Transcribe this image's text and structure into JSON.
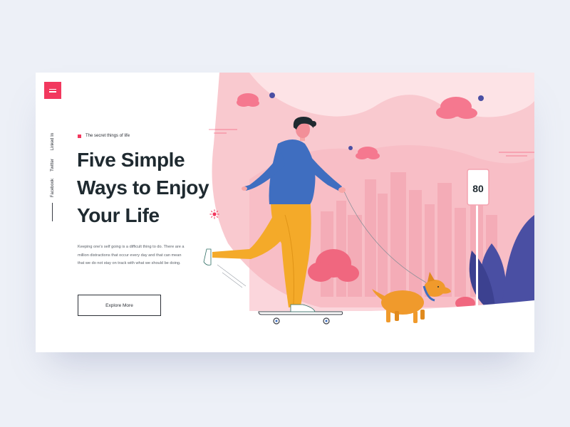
{
  "hero": {
    "eyebrow": "The secret things of life",
    "headline_line1": "Five Simple",
    "headline_line2": "Ways to Enjoy",
    "headline_line3": "Your Life",
    "description": "Keeping one's self going is a difficult thing to do. There are a million distractions that occur every day and that can mean that we do not stay on track with what we should be doing.",
    "cta_label": "Explore More"
  },
  "social": {
    "linkedin": "Linked In",
    "twitter": "Twitter",
    "facebook": "Facebook"
  },
  "scene": {
    "speed_sign": "80"
  },
  "icons": {
    "menu": "hamburger-menu-icon",
    "sun": "sun-icon"
  },
  "colors": {
    "accent": "#f2385e",
    "page_background": "#edf0f7",
    "text_dark": "#1f2a30",
    "scene_pink": "#f9c2c9",
    "jacket_blue": "#3f6ec0",
    "pants_yellow": "#f4aa29",
    "dog_orange": "#f09a2c",
    "bush_purple": "#4a4fa3"
  }
}
